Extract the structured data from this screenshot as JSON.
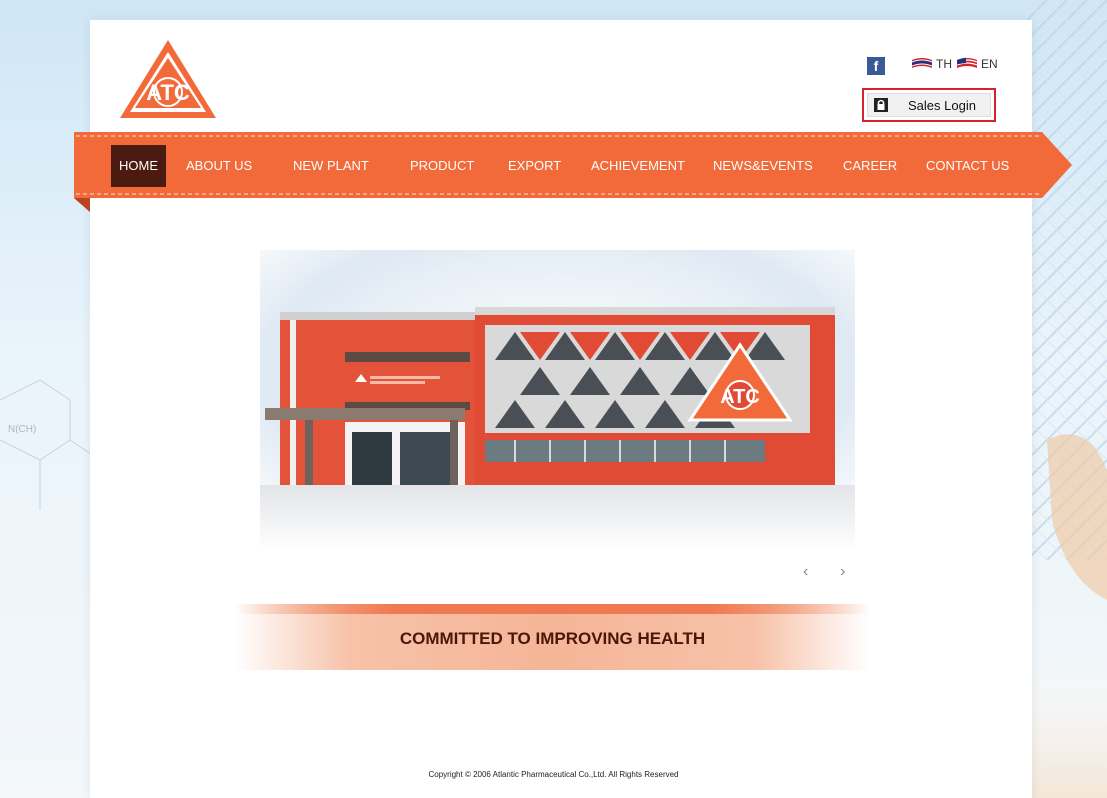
{
  "header": {
    "logo_text": "ATC",
    "languages": [
      {
        "code": "TH",
        "label": "TH"
      },
      {
        "code": "EN",
        "label": "EN"
      }
    ],
    "sales_login_label": "Sales Login"
  },
  "nav": {
    "items": [
      {
        "label": "HOME",
        "active": true
      },
      {
        "label": "ABOUT US",
        "active": false
      },
      {
        "label": "NEW PLANT",
        "active": false
      },
      {
        "label": "PRODUCT",
        "active": false
      },
      {
        "label": "EXPORT",
        "active": false
      },
      {
        "label": "ACHIEVEMENT",
        "active": false
      },
      {
        "label": "NEWS&EVENTS",
        "active": false
      },
      {
        "label": "CAREER",
        "active": false
      },
      {
        "label": "CONTACT US",
        "active": false
      }
    ]
  },
  "hero": {
    "building_logo": "ATC",
    "prev_label": "‹",
    "next_label": "›"
  },
  "tagline": "COMMITTED TO IMPROVING HEALTH",
  "footer": {
    "copyright": "Copyright © 2006 Atlantic Pharmaceutical Co.,Ltd. All Rights Reserved"
  },
  "background": {
    "chem_label": "N(CH)"
  },
  "colors": {
    "brand_orange": "#f26a3a",
    "nav_active": "#4b1a10",
    "login_border": "#d3232e"
  }
}
